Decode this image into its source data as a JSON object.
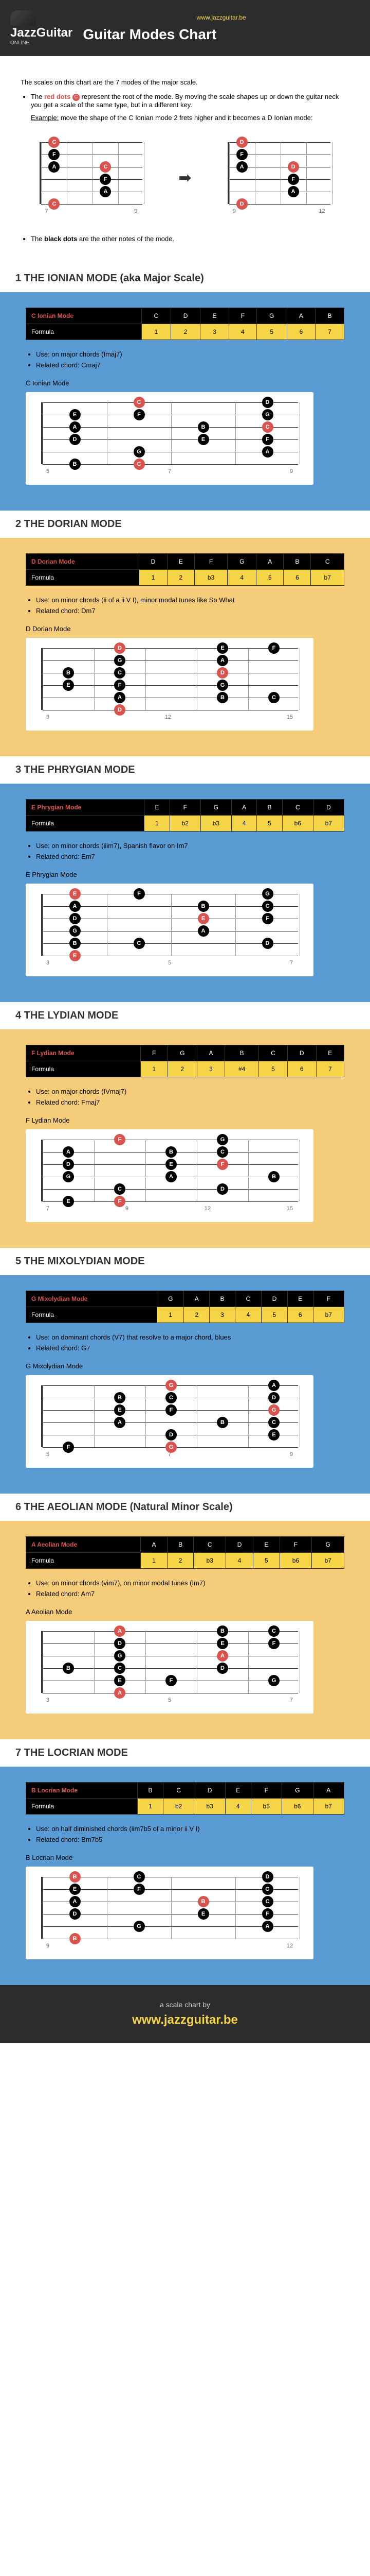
{
  "header": {
    "url": "www.jazzguitar.be",
    "logo_main": "JazzGuitar",
    "logo_sub": "ONLINE",
    "title": "Guitar Modes Chart"
  },
  "intro": {
    "line1": "The scales on this chart are the 7 modes of the major scale.",
    "bullet1_pre": "The ",
    "bullet1_red": "red dots",
    "bullet1_post": " represent the root of the mode. By moving the scale shapes up or down the guitar neck you get a scale of the same type, but in a different key.",
    "example_label": "Example:",
    "example_text": " move the shape of the C Ionian mode 2 frets higher and it becomes a D Ionian mode:",
    "bullet2_pre": "The ",
    "bullet2_bold": "black dots",
    "bullet2_post": " are the other notes of the mode."
  },
  "example_frets_left": [
    "7",
    "9"
  ],
  "example_frets_right": [
    "9",
    "12"
  ],
  "modes": [
    {
      "title": "1 THE IONIAN MODE (aka Major Scale)",
      "bg": "blue-bg",
      "name": "C Ionian Mode",
      "headers": [
        "C",
        "D",
        "E",
        "F",
        "G",
        "A",
        "B"
      ],
      "formula": [
        "1",
        "2",
        "3",
        "4",
        "5",
        "6",
        "7"
      ],
      "use": "on major chords (Imaj7)",
      "chord": "Cmaj7",
      "label": "C Ionian Mode",
      "frets": [
        "5",
        "7",
        "9"
      ],
      "chart_data": {
        "type": "fretboard",
        "root": "C",
        "notes": [
          {
            "string": 1,
            "fret": 3,
            "note": "C",
            "root": true
          },
          {
            "string": 1,
            "fret": 5,
            "note": "D"
          },
          {
            "string": 2,
            "fret": 2,
            "note": "E"
          },
          {
            "string": 2,
            "fret": 3,
            "note": "F"
          },
          {
            "string": 2,
            "fret": 5,
            "note": "G"
          },
          {
            "string": 3,
            "fret": 2,
            "note": "A"
          },
          {
            "string": 3,
            "fret": 4,
            "note": "B"
          },
          {
            "string": 3,
            "fret": 5,
            "note": "C",
            "root": true
          },
          {
            "string": 4,
            "fret": 2,
            "note": "D"
          },
          {
            "string": 4,
            "fret": 4,
            "note": "E"
          },
          {
            "string": 4,
            "fret": 5,
            "note": "F"
          },
          {
            "string": 5,
            "fret": 3,
            "note": "G"
          },
          {
            "string": 5,
            "fret": 5,
            "note": "A"
          },
          {
            "string": 6,
            "fret": 2,
            "note": "B"
          },
          {
            "string": 6,
            "fret": 3,
            "note": "C",
            "root": true
          }
        ]
      }
    },
    {
      "title": "2 THE DORIAN MODE",
      "bg": "orange-bg",
      "name": "D Dorian Mode",
      "headers": [
        "D",
        "E",
        "F",
        "G",
        "A",
        "B",
        "C"
      ],
      "formula": [
        "1",
        "2",
        "b3",
        "4",
        "5",
        "6",
        "b7"
      ],
      "use": "on minor chords (ii of a ii V I), minor modal tunes like So What",
      "chord": "Dm7",
      "label": "D Dorian Mode",
      "frets": [
        "9",
        "12",
        "15"
      ],
      "chart_data": {
        "type": "fretboard",
        "root": "D",
        "notes": [
          {
            "string": 1,
            "fret": 2,
            "note": "D",
            "root": true
          },
          {
            "string": 1,
            "fret": 4,
            "note": "E"
          },
          {
            "string": 1,
            "fret": 5,
            "note": "F"
          },
          {
            "string": 2,
            "fret": 2,
            "note": "G"
          },
          {
            "string": 2,
            "fret": 4,
            "note": "A"
          },
          {
            "string": 3,
            "fret": 1,
            "note": "B"
          },
          {
            "string": 3,
            "fret": 2,
            "note": "C"
          },
          {
            "string": 3,
            "fret": 4,
            "note": "D",
            "root": true
          },
          {
            "string": 4,
            "fret": 1,
            "note": "E"
          },
          {
            "string": 4,
            "fret": 2,
            "note": "F"
          },
          {
            "string": 4,
            "fret": 4,
            "note": "G"
          },
          {
            "string": 5,
            "fret": 2,
            "note": "A"
          },
          {
            "string": 5,
            "fret": 4,
            "note": "B"
          },
          {
            "string": 5,
            "fret": 5,
            "note": "C"
          },
          {
            "string": 6,
            "fret": 2,
            "note": "D",
            "root": true
          }
        ]
      }
    },
    {
      "title": "3 THE PHRYGIAN MODE",
      "bg": "blue-bg",
      "name": "E Phrygian Mode",
      "headers": [
        "E",
        "F",
        "G",
        "A",
        "B",
        "C",
        "D"
      ],
      "formula": [
        "1",
        "b2",
        "b3",
        "4",
        "5",
        "b6",
        "b7"
      ],
      "use": "on minor chords (iiim7), Spanish flavor on Im7",
      "chord": "Em7",
      "label": "E Phrygian Mode",
      "frets": [
        "3",
        "5",
        "7"
      ],
      "chart_data": {
        "type": "fretboard",
        "root": "E",
        "notes": [
          {
            "string": 1,
            "fret": 0,
            "note": "E",
            "root": true
          },
          {
            "string": 1,
            "fret": 1,
            "note": "F"
          },
          {
            "string": 1,
            "fret": 3,
            "note": "G"
          },
          {
            "string": 2,
            "fret": 0,
            "note": "A"
          },
          {
            "string": 2,
            "fret": 2,
            "note": "B"
          },
          {
            "string": 2,
            "fret": 3,
            "note": "C"
          },
          {
            "string": 3,
            "fret": 0,
            "note": "D"
          },
          {
            "string": 3,
            "fret": 2,
            "note": "E",
            "root": true
          },
          {
            "string": 3,
            "fret": 3,
            "note": "F"
          },
          {
            "string": 4,
            "fret": 0,
            "note": "G"
          },
          {
            "string": 4,
            "fret": 2,
            "note": "A"
          },
          {
            "string": 5,
            "fret": 0,
            "note": "B"
          },
          {
            "string": 5,
            "fret": 1,
            "note": "C"
          },
          {
            "string": 5,
            "fret": 3,
            "note": "D"
          },
          {
            "string": 6,
            "fret": 0,
            "note": "E",
            "root": true
          }
        ]
      }
    },
    {
      "title": "4 THE LYDIAN MODE",
      "bg": "orange-bg",
      "name": "F Lydian Mode",
      "headers": [
        "F",
        "G",
        "A",
        "B",
        "C",
        "D",
        "E"
      ],
      "formula": [
        "1",
        "2",
        "3",
        "#4",
        "5",
        "6",
        "7"
      ],
      "use": "on major chords (IVmaj7)",
      "chord": "Fmaj7",
      "label": "F Lydian Mode",
      "frets": [
        "7",
        "9",
        "12",
        "15"
      ],
      "chart_data": {
        "type": "fretboard",
        "root": "F",
        "notes": [
          {
            "string": 1,
            "fret": 1,
            "note": "F",
            "root": true
          },
          {
            "string": 1,
            "fret": 3,
            "note": "G"
          },
          {
            "string": 2,
            "fret": 0,
            "note": "A"
          },
          {
            "string": 2,
            "fret": 2,
            "note": "B"
          },
          {
            "string": 2,
            "fret": 3,
            "note": "C"
          },
          {
            "string": 3,
            "fret": 0,
            "note": "D"
          },
          {
            "string": 3,
            "fret": 2,
            "note": "E"
          },
          {
            "string": 3,
            "fret": 3,
            "note": "F",
            "root": true
          },
          {
            "string": 4,
            "fret": 0,
            "note": "G"
          },
          {
            "string": 4,
            "fret": 2,
            "note": "A"
          },
          {
            "string": 4,
            "fret": 4,
            "note": "B"
          },
          {
            "string": 5,
            "fret": 1,
            "note": "C"
          },
          {
            "string": 5,
            "fret": 3,
            "note": "D"
          },
          {
            "string": 6,
            "fret": 0,
            "note": "E"
          },
          {
            "string": 6,
            "fret": 1,
            "note": "F",
            "root": true
          }
        ]
      }
    },
    {
      "title": "5 THE MIXOLYDIAN MODE",
      "bg": "blue-bg",
      "name": "G Mixolydian Mode",
      "headers": [
        "G",
        "A",
        "B",
        "C",
        "D",
        "E",
        "F"
      ],
      "formula": [
        "1",
        "2",
        "3",
        "4",
        "5",
        "6",
        "b7"
      ],
      "use": "on dominant chords (V7) that resolve to a major chord, blues",
      "chord": "G7",
      "label": "G Mixolydian Mode",
      "frets": [
        "5",
        "7",
        "9"
      ],
      "chart_data": {
        "type": "fretboard",
        "root": "G",
        "notes": [
          {
            "string": 1,
            "fret": 3,
            "note": "G",
            "root": true
          },
          {
            "string": 1,
            "fret": 5,
            "note": "A"
          },
          {
            "string": 2,
            "fret": 2,
            "note": "B"
          },
          {
            "string": 2,
            "fret": 3,
            "note": "C"
          },
          {
            "string": 2,
            "fret": 5,
            "note": "D"
          },
          {
            "string": 3,
            "fret": 2,
            "note": "E"
          },
          {
            "string": 3,
            "fret": 3,
            "note": "F"
          },
          {
            "string": 3,
            "fret": 5,
            "note": "G",
            "root": true
          },
          {
            "string": 4,
            "fret": 2,
            "note": "A"
          },
          {
            "string": 4,
            "fret": 4,
            "note": "B"
          },
          {
            "string": 4,
            "fret": 5,
            "note": "C"
          },
          {
            "string": 5,
            "fret": 3,
            "note": "D"
          },
          {
            "string": 5,
            "fret": 5,
            "note": "E"
          },
          {
            "string": 6,
            "fret": 1,
            "note": "F"
          },
          {
            "string": 6,
            "fret": 3,
            "note": "G",
            "root": true
          }
        ]
      }
    },
    {
      "title": "6 THE AEOLIAN MODE (Natural Minor Scale)",
      "bg": "orange-bg",
      "name": "A Aeolian Mode",
      "headers": [
        "A",
        "B",
        "C",
        "D",
        "E",
        "F",
        "G"
      ],
      "formula": [
        "1",
        "2",
        "b3",
        "4",
        "5",
        "b6",
        "b7"
      ],
      "use": "on minor chords (vim7), on minor modal tunes (Im7)",
      "chord": "Am7",
      "label": "A Aeolian Mode",
      "frets": [
        "3",
        "5",
        "7"
      ],
      "chart_data": {
        "type": "fretboard",
        "root": "A",
        "notes": [
          {
            "string": 1,
            "fret": 5,
            "note": "A",
            "root": true
          },
          {
            "string": 1,
            "fret": 7,
            "note": "B"
          },
          {
            "string": 1,
            "fret": 8,
            "note": "C"
          },
          {
            "string": 2,
            "fret": 5,
            "note": "D"
          },
          {
            "string": 2,
            "fret": 7,
            "note": "E"
          },
          {
            "string": 2,
            "fret": 8,
            "note": "F"
          },
          {
            "string": 3,
            "fret": 5,
            "note": "G"
          },
          {
            "string": 3,
            "fret": 7,
            "note": "A",
            "root": true
          },
          {
            "string": 4,
            "fret": 4,
            "note": "B"
          },
          {
            "string": 4,
            "fret": 5,
            "note": "C"
          },
          {
            "string": 4,
            "fret": 7,
            "note": "D"
          },
          {
            "string": 5,
            "fret": 5,
            "note": "E"
          },
          {
            "string": 5,
            "fret": 6,
            "note": "F"
          },
          {
            "string": 5,
            "fret": 8,
            "note": "G"
          },
          {
            "string": 6,
            "fret": 5,
            "note": "A",
            "root": true
          }
        ]
      }
    },
    {
      "title": "7 THE LOCRIAN MODE",
      "bg": "blue-bg",
      "name": "B Locrian Mode",
      "headers": [
        "B",
        "C",
        "D",
        "E",
        "F",
        "G",
        "A"
      ],
      "formula": [
        "1",
        "b2",
        "b3",
        "4",
        "b5",
        "b6",
        "b7"
      ],
      "use": "on half diminished chords (iim7b5 of a minor ii V I)",
      "chord": "Bm7b5",
      "label": "B Locrian Mode",
      "frets": [
        "9",
        "12"
      ],
      "chart_data": {
        "type": "fretboard",
        "root": "B",
        "notes": [
          {
            "string": 1,
            "fret": 7,
            "note": "B",
            "root": true
          },
          {
            "string": 1,
            "fret": 8,
            "note": "C"
          },
          {
            "string": 1,
            "fret": 10,
            "note": "D"
          },
          {
            "string": 2,
            "fret": 7,
            "note": "E"
          },
          {
            "string": 2,
            "fret": 8,
            "note": "F"
          },
          {
            "string": 2,
            "fret": 10,
            "note": "G"
          },
          {
            "string": 3,
            "fret": 7,
            "note": "A"
          },
          {
            "string": 3,
            "fret": 9,
            "note": "B",
            "root": true
          },
          {
            "string": 3,
            "fret": 10,
            "note": "C"
          },
          {
            "string": 4,
            "fret": 7,
            "note": "D"
          },
          {
            "string": 4,
            "fret": 9,
            "note": "E"
          },
          {
            "string": 4,
            "fret": 10,
            "note": "F"
          },
          {
            "string": 5,
            "fret": 8,
            "note": "G"
          },
          {
            "string": 5,
            "fret": 10,
            "note": "A"
          },
          {
            "string": 6,
            "fret": 7,
            "note": "B",
            "root": true
          }
        ]
      }
    }
  ],
  "footer": {
    "line1": "a scale chart by",
    "url": "www.jazzguitar.be"
  },
  "labels": {
    "formula": "Formula",
    "use_prefix": "Use: ",
    "chord_prefix": "Related chord: "
  }
}
